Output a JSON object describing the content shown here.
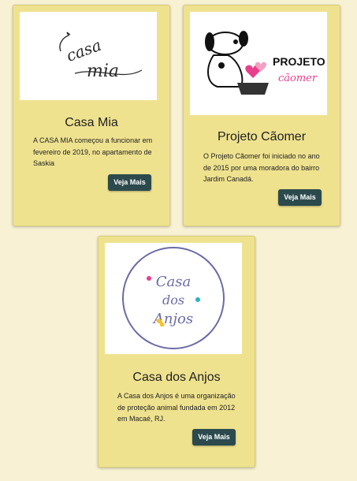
{
  "cards": [
    {
      "title": "Casa Mia",
      "text": "A CASA MIA começou a funcionar em fevereiro de 2019, no apartamento de Saskia",
      "button": "Veja Mais",
      "logo_text": "casa mia"
    },
    {
      "title": "Projeto Cãomer",
      "text": "O Projeto Cãomer foi iniciado no ano de 2015 por uma moradora do bairro Jardim Canadá.",
      "button": "Veja Mais",
      "logo_line1": "PROJETO",
      "logo_line2": "cãomer"
    },
    {
      "title": "Casa dos Anjos",
      "text": "A Casa dos Anjos é uma organização de proteção animal fundada em 2012 em Macaé, RJ.",
      "button": "Veja Mais",
      "logo_text": "Casa dos Anjos"
    }
  ],
  "colors": {
    "page_background": "#f8f1d3",
    "card_background": "#efe28f",
    "button_background": "#2c4a4d",
    "button_text": "#ffffff",
    "caomer_pink": "#e83e8c",
    "anjos_purple": "#6b6aa6"
  }
}
